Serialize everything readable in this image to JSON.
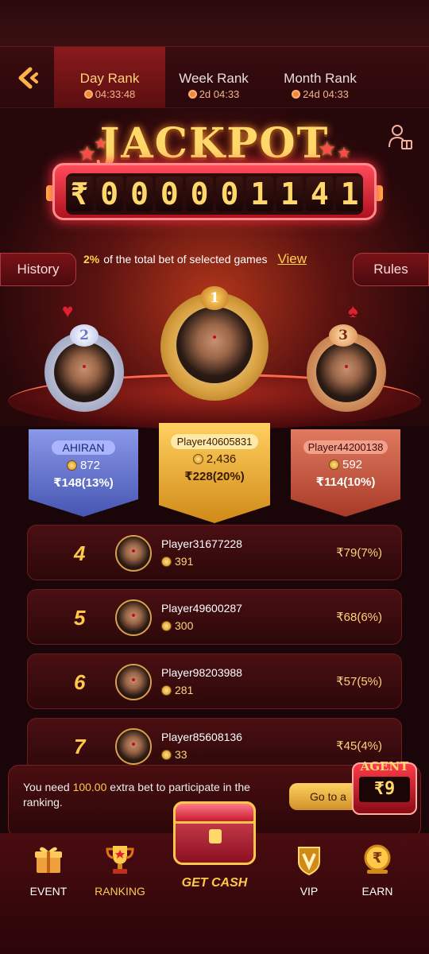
{
  "tabs": [
    {
      "label": "Day Rank",
      "timer": "04:33:48",
      "active": true
    },
    {
      "label": "Week Rank",
      "timer": "2d 04:33",
      "active": false
    },
    {
      "label": "Month Rank",
      "timer": "24d 04:33",
      "active": false
    }
  ],
  "jackpot": {
    "title": "JACKPOT",
    "currency": "₹",
    "digits": [
      "0",
      "0",
      "0",
      "0",
      "0",
      "1",
      "1",
      "4",
      "1"
    ]
  },
  "side_buttons": {
    "history": "History",
    "rules": "Rules"
  },
  "description": {
    "percent": "2%",
    "text": "of the total bet of selected games",
    "link": "View"
  },
  "podium": {
    "first": {
      "rank": "1",
      "name": "Player40605831",
      "coins": "2,436",
      "prize": "₹228(20%)"
    },
    "second": {
      "rank": "2",
      "name": "AHIRAN",
      "coins": "872",
      "prize": "₹148(13%)"
    },
    "third": {
      "rank": "3",
      "name": "Player44200138",
      "coins": "592",
      "prize": "₹114(10%)"
    }
  },
  "ranking_list": [
    {
      "rank": "4",
      "name": "Player31677228",
      "coins": "391",
      "prize": "₹79(7%)"
    },
    {
      "rank": "5",
      "name": "Player49600287",
      "coins": "300",
      "prize": "₹68(6%)"
    },
    {
      "rank": "6",
      "name": "Player98203988",
      "coins": "281",
      "prize": "₹57(5%)"
    },
    {
      "rank": "7",
      "name": "Player85608136",
      "coins": "33",
      "prize": "₹45(4%)"
    }
  ],
  "notice": {
    "pre": "You need ",
    "amount": "100.00",
    "post": " extra bet to participate in the ranking.",
    "button": "Go to a",
    "agent_label": "AGENT",
    "agent_reel": "₹9"
  },
  "nav": {
    "event": "EVENT",
    "ranking": "RANKING",
    "get_cash": "GET CASH",
    "vip": "VIP",
    "earn": "EARN"
  },
  "colors": {
    "accent_gold": "#ffc84a",
    "bg_dark": "#1a0608",
    "jackpot_red": "#d01a2c"
  }
}
